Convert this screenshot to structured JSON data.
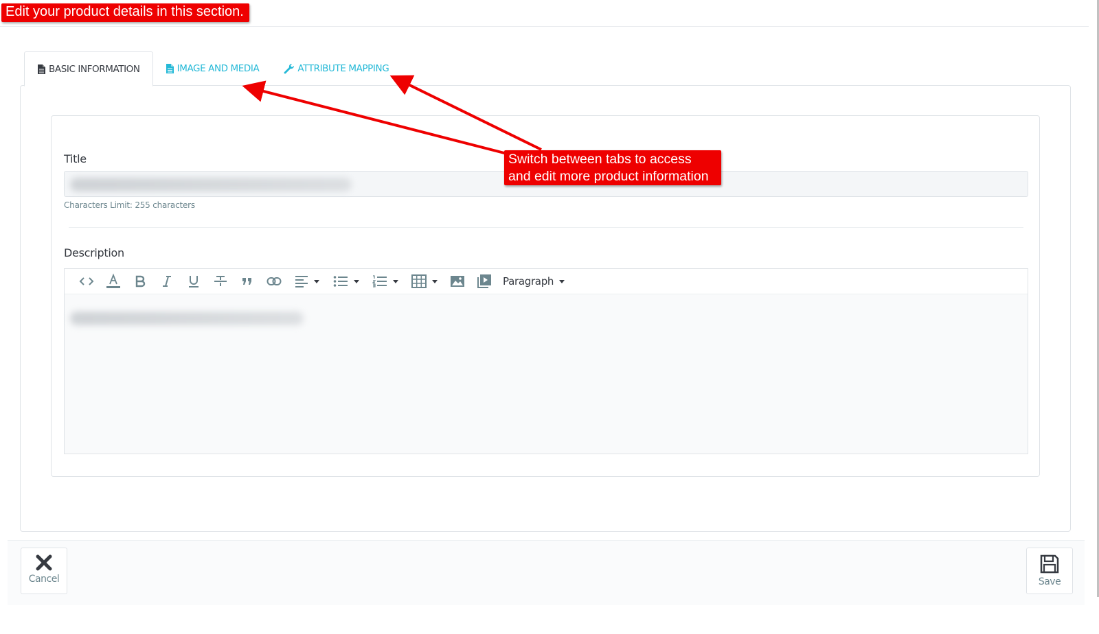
{
  "annotations": {
    "top_callout": "Edit your product details in this section.",
    "tabs_callout_line1": "Switch between tabs to access",
    "tabs_callout_line2": "and edit more product information"
  },
  "tabs": [
    {
      "label": "BASIC INFORMATION",
      "icon": "file-text-icon",
      "active": true
    },
    {
      "label": "IMAGE AND MEDIA",
      "icon": "file-text-icon",
      "active": false
    },
    {
      "label": "ATTRIBUTE MAPPING",
      "icon": "wrench-icon",
      "active": false
    }
  ],
  "form": {
    "title_label": "Title",
    "title_hint": "Characters Limit: 255 characters",
    "description_label": "Description",
    "editor_toolbar": {
      "buttons": [
        "code-view-icon",
        "font-color-icon",
        "bold-icon",
        "italic-icon",
        "underline-icon",
        "strikethrough-icon",
        "blockquote-icon",
        "link-icon",
        "align-icon",
        "bullet-list-icon",
        "numbered-list-icon",
        "table-icon",
        "image-icon",
        "video-icon"
      ],
      "paragraph_label": "Paragraph"
    }
  },
  "footer": {
    "cancel_label": "Cancel",
    "save_label": "Save"
  },
  "colors": {
    "accent": "#25b9d7",
    "annotation_red": "#ee0000",
    "text": "#363a41",
    "muted": "#6c868e"
  }
}
